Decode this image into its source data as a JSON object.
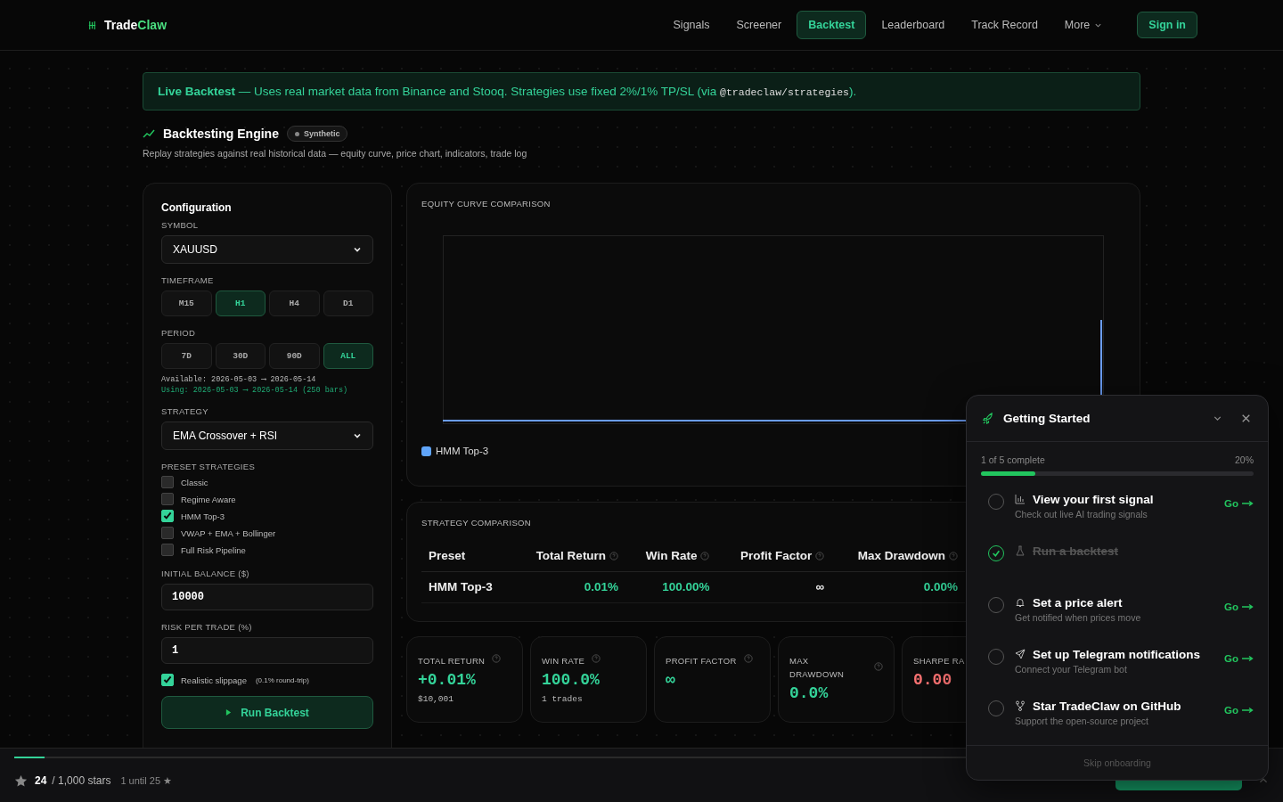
{
  "header": {
    "logo_main": "Trade",
    "logo_accent": "Claw",
    "nav": [
      {
        "label": "Signals",
        "selected": false
      },
      {
        "label": "Screener",
        "selected": false
      },
      {
        "label": "Backtest",
        "selected": true
      },
      {
        "label": "Leaderboard",
        "selected": false
      },
      {
        "label": "Track Record",
        "selected": false
      }
    ],
    "more": "More",
    "sign_in": "Sign in"
  },
  "banner": {
    "text": "**Live Backtest** — Uses real market data from Binance and Stooq. Strategies use fixed 2%/1% TP/SL (via ",
    "code": "@tradeclaw/strategies",
    "end": ")."
  },
  "page": {
    "title": "Backtesting Engine",
    "badge": "Synthetic",
    "subtitle": "Replay strategies against real historical data — equity curve, price chart, indicators, trade log"
  },
  "config": {
    "title": "Configuration",
    "symbol_label": "SYMBOL",
    "symbol": "XAUUSD",
    "timeframe_label": "TIMEFRAME",
    "timeframes": [
      {
        "label": "M15",
        "selected": false
      },
      {
        "label": "H1",
        "selected": true
      },
      {
        "label": "H4",
        "selected": false
      },
      {
        "label": "D1",
        "selected": false
      }
    ],
    "period_label": "PERIOD",
    "periods": [
      {
        "label": "7D",
        "selected": false
      },
      {
        "label": "30D",
        "selected": false
      },
      {
        "label": "90D",
        "selected": false
      },
      {
        "label": "ALL",
        "selected": true
      }
    ],
    "available": "Available: 2026-05-03 ⟶ 2026-05-14",
    "using": "Using: 2026-05-03 ⟶ 2026-05-14 (250 bars)",
    "strategy_label": "STRATEGY",
    "strategy": "EMA Crossover + RSI",
    "presets_label": "PRESET STRATEGIES",
    "presets": [
      {
        "label": "Classic",
        "checked": false
      },
      {
        "label": "Regime Aware",
        "checked": false
      },
      {
        "label": "HMM Top-3",
        "checked": true
      },
      {
        "label": "VWAP + EMA + Bollinger",
        "checked": false
      },
      {
        "label": "Full Risk Pipeline",
        "checked": false
      }
    ],
    "balance_label": "INITIAL BALANCE ($)",
    "balance": "10000",
    "risk_label": "RISK PER TRADE (%)",
    "risk": "1",
    "slippage": {
      "label": "Realistic slippage",
      "note": "(0.1% round-trip)",
      "checked": true
    },
    "run": "Run Backtest"
  },
  "equity": {
    "title": "EQUITY CURVE COMPARISON",
    "legend": [
      {
        "label": "HMM Top-3",
        "color": "#60a5fa"
      }
    ]
  },
  "comparison": {
    "title": "STRATEGY COMPARISON",
    "columns": [
      {
        "label": "Preset",
        "help": false
      },
      {
        "label": "Total Return",
        "help": true
      },
      {
        "label": "Win Rate",
        "help": true
      },
      {
        "label": "Profit Factor",
        "help": true
      },
      {
        "label": "Max Drawdown",
        "help": true
      }
    ],
    "rows": [
      {
        "cells": [
          {
            "text": "HMM Top-3",
            "positive": false
          },
          {
            "text": "0.01%",
            "positive": true
          },
          {
            "text": "100.00%",
            "positive": true
          },
          {
            "text": "∞",
            "positive": false
          },
          {
            "text": "0.00%",
            "positive": true
          }
        ]
      }
    ]
  },
  "stats": [
    {
      "label": "TOTAL RETURN",
      "value": "+0.01%",
      "sub": "$10,001",
      "negative": false,
      "help": true
    },
    {
      "label": "WIN RATE",
      "value": "100.0%",
      "sub": "1 trades",
      "negative": false,
      "help": true
    },
    {
      "label": "PROFIT FACTOR",
      "value": "∞",
      "negative": false,
      "help": true
    },
    {
      "label": "MAX DRAWDOWN",
      "value": "0.0%",
      "negative": false,
      "help": true
    },
    {
      "label": "SHARPE RA",
      "value": "0.00",
      "negative": true,
      "help": false
    }
  ],
  "onboarding": {
    "title": "Getting Started",
    "progress_text": "1 of 5 complete",
    "percent": "20%",
    "level": 0.2,
    "items": [
      {
        "title": "View your first signal",
        "subtitle": "Check out live AI trading signals",
        "done": false,
        "go": "Go"
      },
      {
        "title": "Run a backtest",
        "done": true
      },
      {
        "title": "Set a price alert",
        "subtitle": "Get notified when prices move",
        "done": false,
        "go": "Go"
      },
      {
        "title": "Set up Telegram notifications",
        "subtitle": "Connect your Telegram bot",
        "done": false,
        "go": "Go"
      },
      {
        "title": "Star TradeClaw on GitHub",
        "subtitle": "Support the open-source project",
        "done": false,
        "go": "Go"
      }
    ],
    "skip": "Skip onboarding"
  },
  "footer": {
    "level": 0.024,
    "count": "24",
    "total": "/ 1,000 stars",
    "until": "1 until 25 ★"
  }
}
